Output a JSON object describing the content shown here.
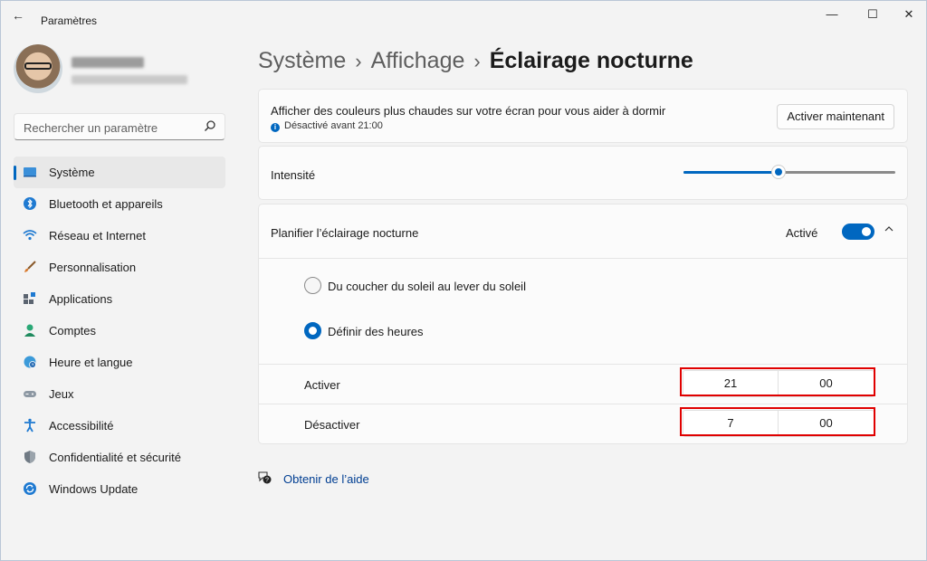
{
  "window": {
    "title": "Paramètres",
    "controls": {
      "minimize": "—",
      "maximize": "☐",
      "close": "✕"
    }
  },
  "sidebar": {
    "search": {
      "placeholder": "Rechercher un paramètre"
    },
    "items": [
      {
        "label": "Système",
        "icon": "display-icon",
        "active": true
      },
      {
        "label": "Bluetooth et appareils",
        "icon": "bluetooth-icon"
      },
      {
        "label": "Réseau et Internet",
        "icon": "wifi-icon"
      },
      {
        "label": "Personnalisation",
        "icon": "brush-icon"
      },
      {
        "label": "Applications",
        "icon": "apps-icon"
      },
      {
        "label": "Comptes",
        "icon": "account-icon"
      },
      {
        "label": "Heure et langue",
        "icon": "globe-clock-icon"
      },
      {
        "label": "Jeux",
        "icon": "gamepad-icon"
      },
      {
        "label": "Accessibilité",
        "icon": "accessibility-icon"
      },
      {
        "label": "Confidentialité et sécurité",
        "icon": "shield-icon"
      },
      {
        "label": "Windows Update",
        "icon": "update-icon"
      }
    ]
  },
  "breadcrumb": {
    "part1": "Système",
    "part2": "Affichage",
    "current": "Éclairage nocturne",
    "separator": "›"
  },
  "night_light": {
    "description": "Afficher des couleurs plus chaudes sur votre écran pour vous aider à dormir",
    "status": "Désactivé avant 21:00",
    "activate_button": "Activer maintenant"
  },
  "intensity": {
    "label": "Intensité",
    "level_fraction": 0.45
  },
  "schedule": {
    "title": "Planifier l’éclairage nocturne",
    "state": "Activé",
    "enabled": true,
    "options": [
      {
        "label": "Du coucher du soleil au lever du soleil",
        "selected": false
      },
      {
        "label": "Définir des heures",
        "selected": true
      }
    ],
    "turn_on": {
      "label": "Activer",
      "hour": "21",
      "minute": "00"
    },
    "turn_off": {
      "label": "Désactiver",
      "hour": "7",
      "minute": "00"
    }
  },
  "help": {
    "label": "Obtenir de l’aide"
  },
  "colors": {
    "accent": "#0067c0",
    "highlight": "#e00000"
  }
}
